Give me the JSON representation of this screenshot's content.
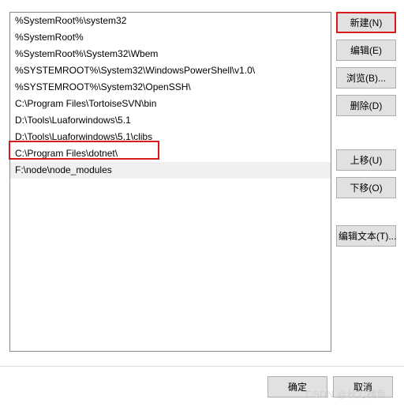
{
  "listbox": {
    "items": [
      "%SystemRoot%\\system32",
      "%SystemRoot%",
      "%SystemRoot%\\System32\\Wbem",
      "%SYSTEMROOT%\\System32\\WindowsPowerShell\\v1.0\\",
      "%SYSTEMROOT%\\System32\\OpenSSH\\",
      "C:\\Program Files\\TortoiseSVN\\bin",
      "D:\\Tools\\Luaforwindows\\5.1",
      "D:\\Tools\\Luaforwindows\\5.1\\clibs",
      "C:\\Program Files\\dotnet\\",
      "F:\\node\\node_modules"
    ],
    "selected_index": 9
  },
  "buttons": {
    "new": "新建(N)",
    "edit": "编辑(E)",
    "browse": "浏览(B)...",
    "delete": "删除(D)",
    "move_up": "上移(U)",
    "move_down": "下移(O)",
    "edit_text": "编辑文本(T)..."
  },
  "footer": {
    "ok": "确定",
    "cancel": "取消"
  },
  "watermark": "CSDN @秋刀槐鱼"
}
